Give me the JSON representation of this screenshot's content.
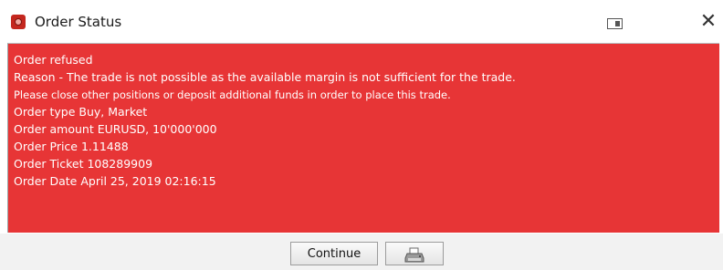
{
  "window": {
    "title": "Order Status",
    "close_glyph": "✕"
  },
  "message": {
    "background_color": "#e73536",
    "lines": [
      "Order refused",
      "Reason - The trade is not possible as the available margin is not sufficient for the trade.",
      "Please close other positions or deposit additional funds in order to place this trade.",
      "Order type Buy, Market",
      "Order amount EURUSD, 10'000'000",
      "Order Price 1.11488",
      "Order Ticket 108289909",
      "Order Date April 25, 2019 02:16:15"
    ]
  },
  "footer": {
    "continue_label": "Continue",
    "print_icon": "printer-icon"
  },
  "icons": {
    "app": "app-logo-icon",
    "dock": "dock-window-icon",
    "close": "close-icon"
  }
}
